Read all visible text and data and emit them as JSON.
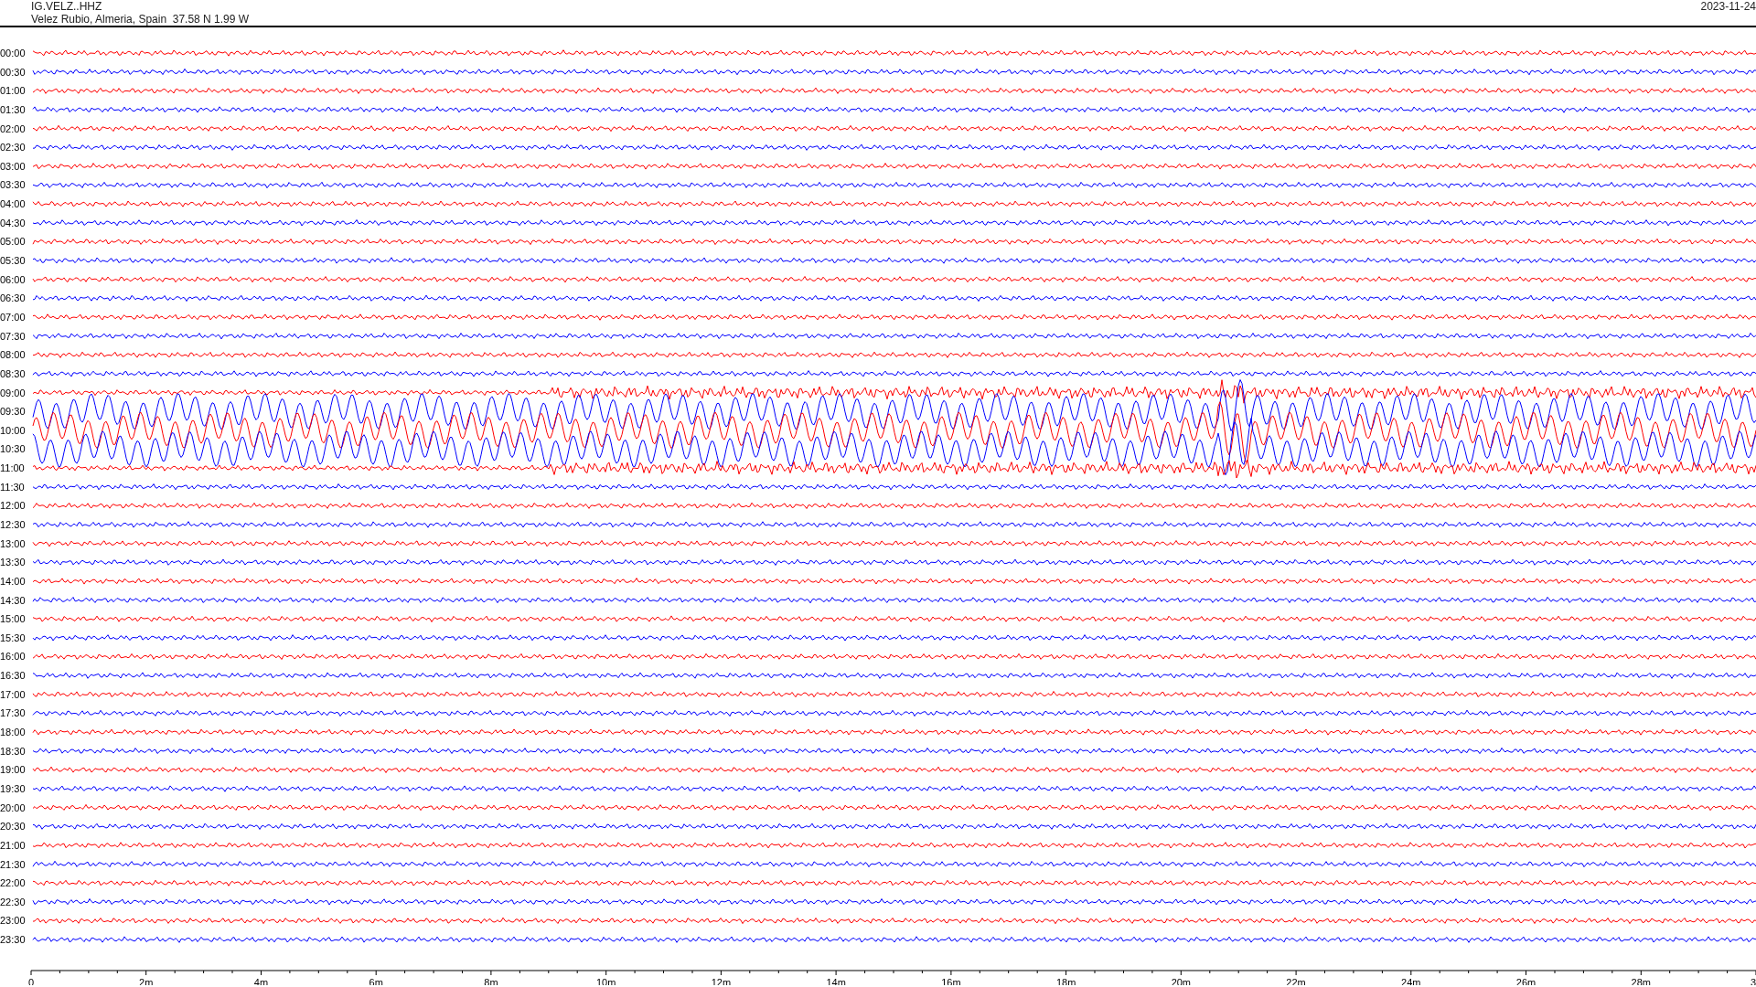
{
  "header": {
    "station": "IG.VELZ..HHZ",
    "location": "Velez Rubio, Almeria, Spain  37.58 N 1.99 W",
    "date": "2023-11-24"
  },
  "traces": [
    {
      "time": "00:00",
      "color": "#ff0000",
      "kind": "quiet"
    },
    {
      "time": "00:30",
      "color": "#0000ff",
      "kind": "quiet"
    },
    {
      "time": "01:00",
      "color": "#ff0000",
      "kind": "quiet"
    },
    {
      "time": "01:30",
      "color": "#0000ff",
      "kind": "quiet"
    },
    {
      "time": "02:00",
      "color": "#ff0000",
      "kind": "quiet"
    },
    {
      "time": "02:30",
      "color": "#0000ff",
      "kind": "quiet"
    },
    {
      "time": "03:00",
      "color": "#ff0000",
      "kind": "quiet"
    },
    {
      "time": "03:30",
      "color": "#0000ff",
      "kind": "quiet"
    },
    {
      "time": "04:00",
      "color": "#ff0000",
      "kind": "quiet"
    },
    {
      "time": "04:30",
      "color": "#0000ff",
      "kind": "quiet"
    },
    {
      "time": "05:00",
      "color": "#ff0000",
      "kind": "quiet"
    },
    {
      "time": "05:30",
      "color": "#0000ff",
      "kind": "quiet"
    },
    {
      "time": "06:00",
      "color": "#ff0000",
      "kind": "quiet"
    },
    {
      "time": "06:30",
      "color": "#0000ff",
      "kind": "quiet"
    },
    {
      "time": "07:00",
      "color": "#ff0000",
      "kind": "quiet"
    },
    {
      "time": "07:30",
      "color": "#0000ff",
      "kind": "quiet"
    },
    {
      "time": "08:00",
      "color": "#ff0000",
      "kind": "quiet"
    },
    {
      "time": "08:30",
      "color": "#0000ff",
      "kind": "quiet"
    },
    {
      "time": "09:00",
      "color": "#ff0000",
      "kind": "onset"
    },
    {
      "time": "09:30",
      "color": "#0000ff",
      "kind": "event"
    },
    {
      "time": "10:00",
      "color": "#ff0000",
      "kind": "event"
    },
    {
      "time": "10:30",
      "color": "#0000ff",
      "kind": "event"
    },
    {
      "time": "11:00",
      "color": "#ff0000",
      "kind": "onset"
    },
    {
      "time": "11:30",
      "color": "#0000ff",
      "kind": "quiet"
    },
    {
      "time": "12:00",
      "color": "#ff0000",
      "kind": "quiet"
    },
    {
      "time": "12:30",
      "color": "#0000ff",
      "kind": "quiet"
    },
    {
      "time": "13:00",
      "color": "#ff0000",
      "kind": "quiet"
    },
    {
      "time": "13:30",
      "color": "#0000ff",
      "kind": "quiet"
    },
    {
      "time": "14:00",
      "color": "#ff0000",
      "kind": "quiet"
    },
    {
      "time": "14:30",
      "color": "#0000ff",
      "kind": "quiet"
    },
    {
      "time": "15:00",
      "color": "#ff0000",
      "kind": "quiet"
    },
    {
      "time": "15:30",
      "color": "#0000ff",
      "kind": "quiet"
    },
    {
      "time": "16:00",
      "color": "#ff0000",
      "kind": "quiet"
    },
    {
      "time": "16:30",
      "color": "#0000ff",
      "kind": "quiet"
    },
    {
      "time": "17:00",
      "color": "#ff0000",
      "kind": "quiet"
    },
    {
      "time": "17:30",
      "color": "#0000ff",
      "kind": "quiet"
    },
    {
      "time": "18:00",
      "color": "#ff0000",
      "kind": "quiet"
    },
    {
      "time": "18:30",
      "color": "#0000ff",
      "kind": "quiet"
    },
    {
      "time": "19:00",
      "color": "#ff0000",
      "kind": "quiet"
    },
    {
      "time": "19:30",
      "color": "#0000ff",
      "kind": "quiet"
    },
    {
      "time": "20:00",
      "color": "#ff0000",
      "kind": "quiet"
    },
    {
      "time": "20:30",
      "color": "#0000ff",
      "kind": "quiet"
    },
    {
      "time": "21:00",
      "color": "#ff0000",
      "kind": "quiet"
    },
    {
      "time": "21:30",
      "color": "#0000ff",
      "kind": "quiet"
    },
    {
      "time": "22:00",
      "color": "#ff0000",
      "kind": "quiet"
    },
    {
      "time": "22:30",
      "color": "#0000ff",
      "kind": "quiet"
    },
    {
      "time": "23:00",
      "color": "#ff0000",
      "kind": "quiet"
    },
    {
      "time": "23:30",
      "color": "#0000ff",
      "kind": "quiet"
    }
  ],
  "time_axis": {
    "labels": [
      "0",
      "2m",
      "4m",
      "6m",
      "8m",
      "10m",
      "12m",
      "14m",
      "16m",
      "18m",
      "20m",
      "22m",
      "24m",
      "26m",
      "28m",
      "3"
    ]
  }
}
